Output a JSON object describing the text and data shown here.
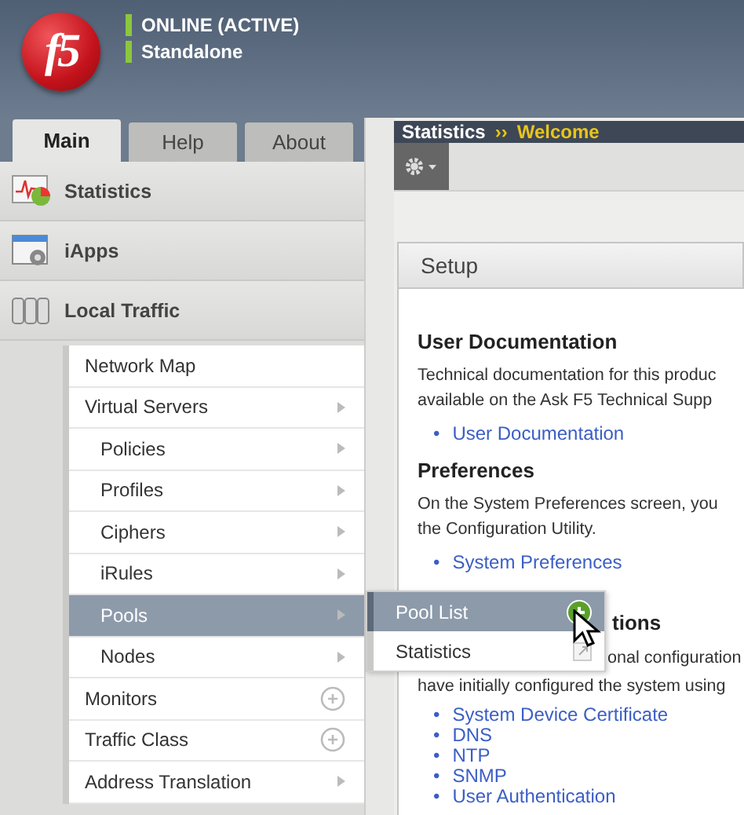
{
  "logo": "f5",
  "status": [
    {
      "text": "ONLINE (ACTIVE)",
      "color": "#8cc63f"
    },
    {
      "text": "Standalone",
      "color": "#8cc63f"
    }
  ],
  "tabs": [
    {
      "label": "Main",
      "selected": true
    },
    {
      "label": "Help",
      "selected": false
    },
    {
      "label": "About",
      "selected": false
    }
  ],
  "sections": [
    {
      "label": "Statistics",
      "kind": "statistics"
    },
    {
      "label": "iApps",
      "kind": "iapps"
    },
    {
      "label": "Local Traffic",
      "kind": "traffic"
    }
  ],
  "menu": [
    {
      "label": "Network Map",
      "kind": "plain",
      "selected": false
    },
    {
      "label": "Virtual Servers",
      "kind": "arrow",
      "selected": false,
      "children": [
        {
          "label": "Policies",
          "kind": "arrow",
          "selected": false
        },
        {
          "label": "Profiles",
          "kind": "arrow",
          "selected": false
        },
        {
          "label": "Ciphers",
          "kind": "arrow",
          "selected": false
        },
        {
          "label": "iRules",
          "kind": "arrow",
          "selected": false
        },
        {
          "label": "Pools",
          "kind": "arrow",
          "selected": true
        },
        {
          "label": "Nodes",
          "kind": "arrow",
          "selected": false
        }
      ]
    },
    {
      "label": "Monitors",
      "kind": "add",
      "selected": false
    },
    {
      "label": "Traffic Class",
      "kind": "add",
      "selected": false
    },
    {
      "label": "Address Translation",
      "kind": "arrow",
      "selected": false
    }
  ],
  "flyout": [
    {
      "label": "Pool List",
      "kind": "add",
      "selected": true
    },
    {
      "label": "Statistics",
      "kind": "external",
      "selected": false
    }
  ],
  "breadcrumb": {
    "parent": "Statistics",
    "separator": "››",
    "current": "Welcome"
  },
  "panel": {
    "title": "Setup",
    "bullet": "•",
    "blocks": [
      {
        "heading": "User Documentation",
        "covered": false,
        "lines": [
          "Technical documentation for this produc",
          "available on the Ask F5 Technical Supp"
        ],
        "links": [
          "User Documentation"
        ]
      },
      {
        "heading": "Preferences",
        "covered": false,
        "lines": [
          "On the System Preferences screen, you",
          "the Configuration Utility."
        ],
        "links": [
          "System Preferences"
        ]
      },
      {
        "heading": "tions",
        "covered": true,
        "lines": [
          "onal configuration",
          "have initially configured the system using"
        ],
        "links": [
          "System Device Certificate",
          "DNS",
          "NTP",
          "SNMP",
          "User Authentication"
        ]
      }
    ]
  }
}
